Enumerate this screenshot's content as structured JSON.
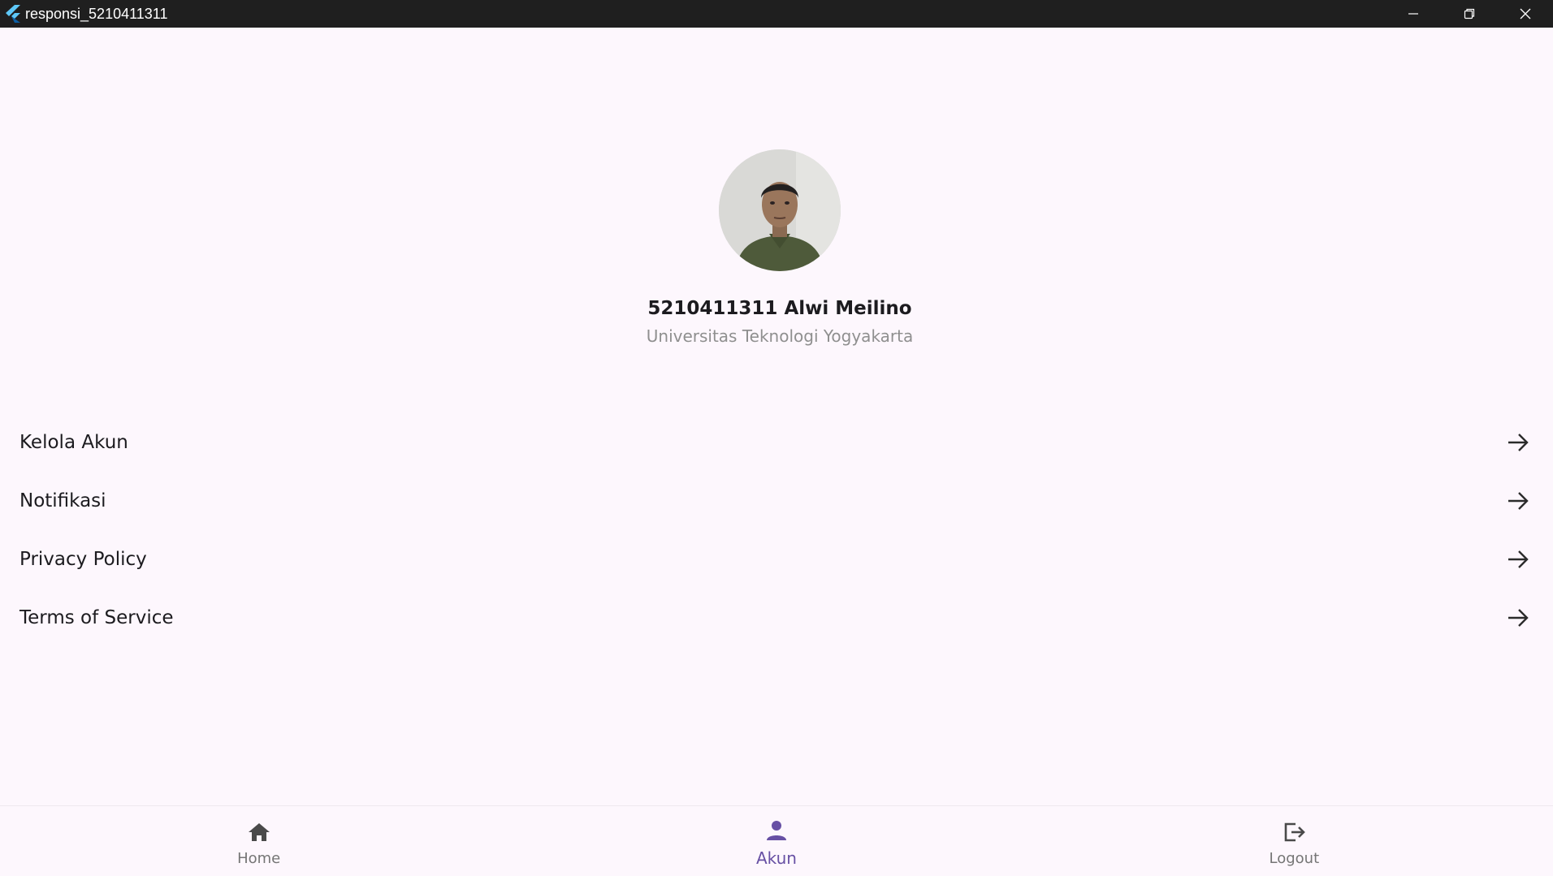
{
  "window": {
    "title": "responsi_5210411311"
  },
  "profile": {
    "name": "5210411311 Alwi Meilino",
    "institution": "Universitas Teknologi Yogyakarta"
  },
  "menu": {
    "items": [
      {
        "label": "Kelola Akun",
        "icon": "arrow-right-icon"
      },
      {
        "label": "Notifikasi",
        "icon": "arrow-right-icon"
      },
      {
        "label": "Privacy Policy",
        "icon": "arrow-right-icon"
      },
      {
        "label": "Terms of Service",
        "icon": "arrow-right-icon"
      }
    ]
  },
  "bottom_nav": {
    "items": [
      {
        "label": "Home",
        "icon": "home-icon",
        "active": false
      },
      {
        "label": "Akun",
        "icon": "person-icon",
        "active": true
      },
      {
        "label": "Logout",
        "icon": "logout-icon",
        "active": false
      }
    ]
  },
  "colors": {
    "background": "#fdf7fd",
    "titlebar": "#1f1f1f",
    "accent": "#6750a4",
    "inactive": "#757575"
  }
}
